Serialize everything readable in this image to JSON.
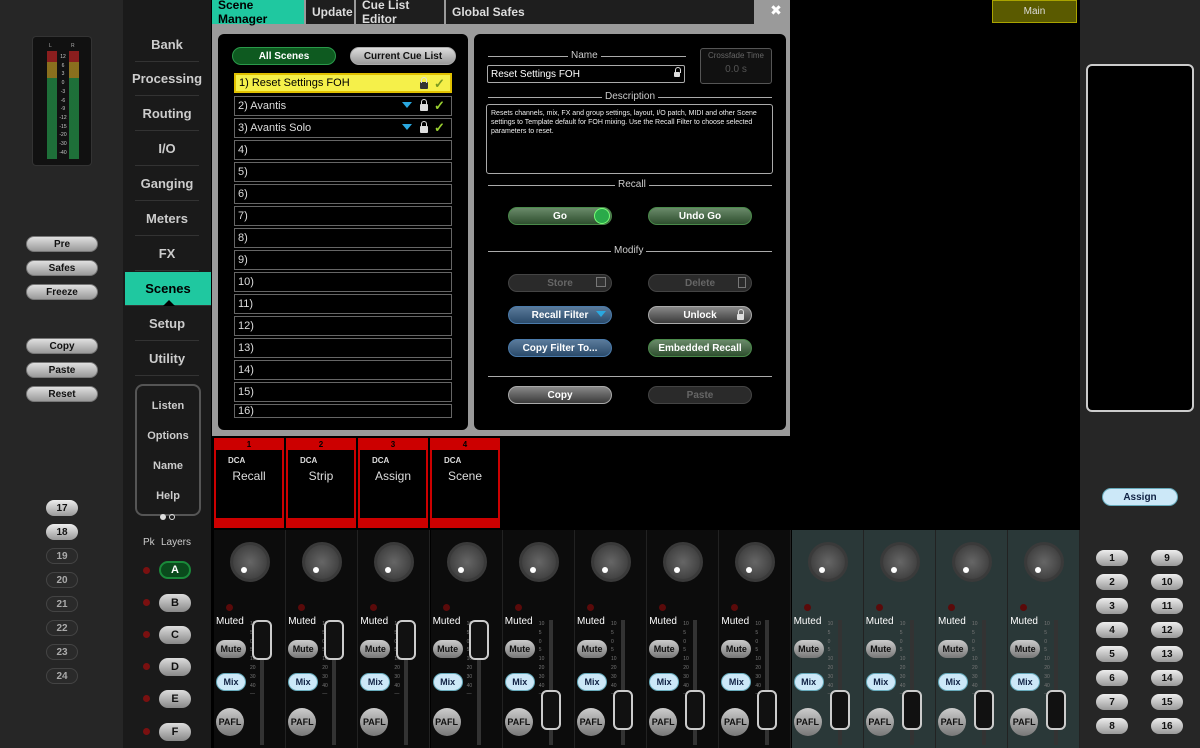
{
  "left_panel": {
    "meter_labels": [
      "L",
      "R"
    ],
    "meter_scale": [
      "12",
      "6",
      "3",
      "0",
      "-3",
      "-6",
      "-9",
      "-12",
      "-15",
      "-20",
      "-30",
      "-40"
    ],
    "buttons": {
      "pre": "Pre",
      "safes": "Safes",
      "freeze": "Freeze",
      "copy": "Copy",
      "paste": "Paste",
      "reset": "Reset"
    },
    "bank_numbers": [
      "17",
      "18",
      "19",
      "20",
      "21",
      "22",
      "23",
      "24"
    ]
  },
  "nav": {
    "items": [
      "Bank",
      "Processing",
      "Routing",
      "I/O",
      "Ganging",
      "Meters",
      "FX",
      "Scenes",
      "Setup",
      "Utility"
    ],
    "active": "Scenes",
    "sub_items": [
      "Listen",
      "Options",
      "Name",
      "Help"
    ],
    "layers_label": "Layers",
    "pk_label": "Pk",
    "layers": [
      "A",
      "B",
      "C",
      "D",
      "E",
      "F"
    ]
  },
  "scene_window": {
    "tabs": [
      "Scene Manager",
      "Update",
      "Cue List Editor",
      "Global Safes"
    ],
    "active_tab": "Scene Manager",
    "close": "✖",
    "filter_tabs": {
      "all": "All Scenes",
      "cue": "Current Cue List"
    },
    "scenes": [
      "1) Reset Settings FOH",
      "2) Avantis",
      "3) Avantis Solo",
      "4)",
      "5)",
      "6)",
      "7)",
      "8)",
      "9)",
      "10)",
      "11)",
      "12)",
      "13)",
      "14)",
      "15)",
      "16)"
    ],
    "name_label": "Name",
    "name_value": "Reset Settings FOH",
    "crossfade_label": "Crossfade Time",
    "crossfade_value": "0.0 s",
    "description_label": "Description",
    "description": "Resets channels, mix, FX and group settings, layout, I/O patch, MIDI and other Scene settings to Template default for FOH mixing.  Use the Recall Filter to choose selected parameters to reset.",
    "recall_label": "Recall",
    "go": "Go",
    "undo_go": "Undo Go",
    "modify_label": "Modify",
    "store": "Store",
    "delete": "Delete",
    "recall_filter": "Recall Filter",
    "unlock": "Unlock",
    "copy_filter": "Copy Filter To...",
    "embedded_recall": "Embedded Recall",
    "copy": "Copy",
    "paste": "Paste"
  },
  "softkeys": [
    {
      "num": "1",
      "type": "DCA",
      "label": "Recall"
    },
    {
      "num": "2",
      "type": "DCA",
      "label": "Strip"
    },
    {
      "num": "3",
      "type": "DCA",
      "label": "Assign"
    },
    {
      "num": "4",
      "type": "DCA",
      "label": "Scene"
    }
  ],
  "strip_labels": {
    "muted": "Muted",
    "mute": "Mute",
    "mix": "Mix",
    "pafl": "PAFL"
  },
  "fader_scale": [
    "10",
    "5",
    "0",
    "5",
    "10",
    "20",
    "30",
    "40",
    "—"
  ],
  "right_panel": {
    "main": "Main",
    "assign": "Assign",
    "numbers_left": [
      "1",
      "2",
      "3",
      "4",
      "5",
      "6",
      "7",
      "8"
    ],
    "numbers_right": [
      "9",
      "10",
      "11",
      "12",
      "13",
      "14",
      "15",
      "16"
    ]
  }
}
